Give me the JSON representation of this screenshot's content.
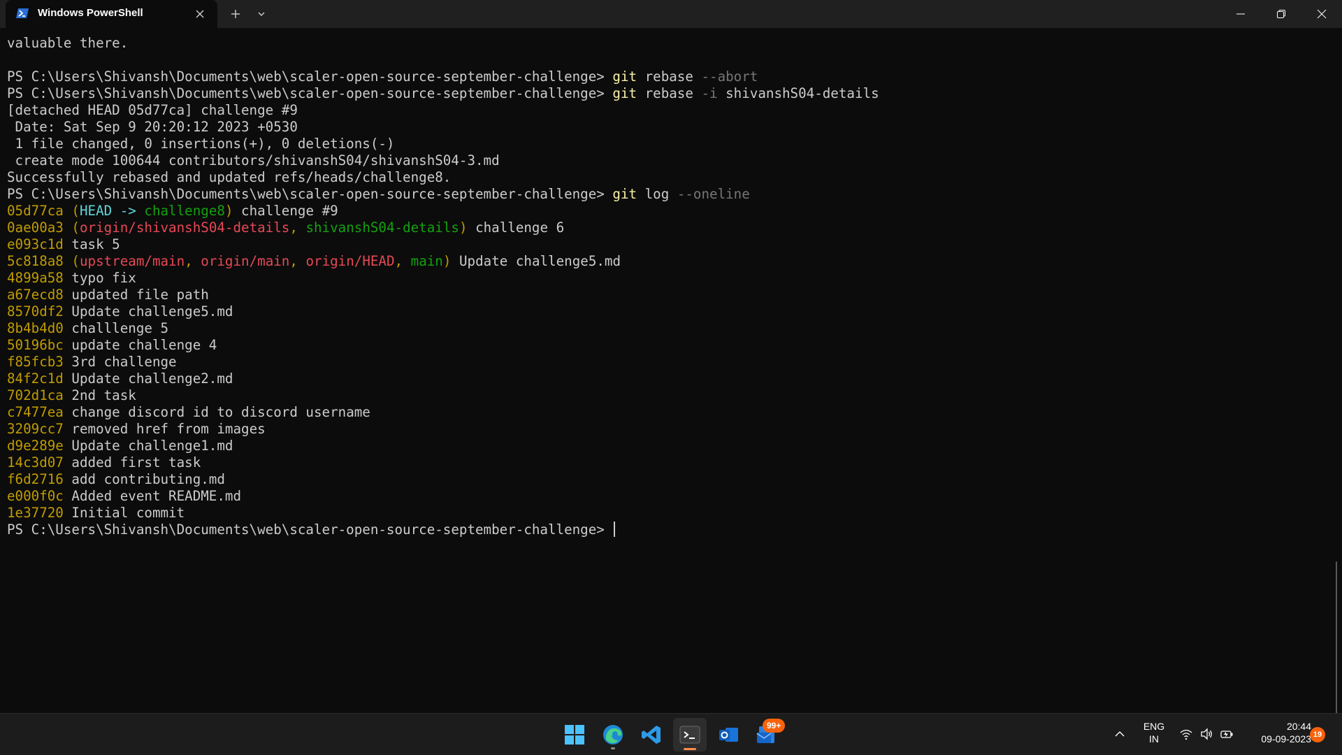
{
  "window": {
    "tab_title": "Windows PowerShell",
    "new_tab_label": "+",
    "icons": [
      "powershell-icon",
      "close-icon",
      "plus-icon",
      "chevron-down-icon",
      "minimize-icon",
      "restore-icon",
      "close-window-icon"
    ]
  },
  "terminal": {
    "lines": [
      [
        [
          "valuable there.",
          "text"
        ]
      ],
      [],
      [
        [
          "PS C:\\Users\\Shivansh\\Documents\\web\\scaler-open-source-september-challenge> ",
          "text"
        ],
        [
          "git",
          "cmd"
        ],
        [
          " rebase ",
          "text"
        ],
        [
          "--abort",
          "flag"
        ]
      ],
      [
        [
          "PS C:\\Users\\Shivansh\\Documents\\web\\scaler-open-source-september-challenge> ",
          "text"
        ],
        [
          "git",
          "cmd"
        ],
        [
          " rebase ",
          "text"
        ],
        [
          "-i",
          "flag"
        ],
        [
          " shivanshS04-details",
          "text"
        ]
      ],
      [
        [
          "[detached HEAD 05d77ca] challenge #9",
          "text"
        ]
      ],
      [
        [
          " Date: Sat Sep 9 20:20:12 2023 +0530",
          "text"
        ]
      ],
      [
        [
          " 1 file changed, 0 insertions(+), 0 deletions(-)",
          "text"
        ]
      ],
      [
        [
          " create mode 100644 contributors/shivanshS04/shivanshS04-3.md",
          "text"
        ]
      ],
      [
        [
          "Successfully rebased and updated refs/heads/challenge8.",
          "text"
        ]
      ],
      [
        [
          "PS C:\\Users\\Shivansh\\Documents\\web\\scaler-open-source-september-challenge> ",
          "text"
        ],
        [
          "git",
          "cmd"
        ],
        [
          " log ",
          "text"
        ],
        [
          "--oneline",
          "flag"
        ]
      ],
      [
        [
          "05d77ca",
          "hash"
        ],
        [
          " (",
          "hash"
        ],
        [
          "HEAD -> ",
          "cyan2"
        ],
        [
          "challenge8",
          "green"
        ],
        [
          ")",
          "hash"
        ],
        [
          " challenge #9",
          "text"
        ]
      ],
      [
        [
          "0ae00a3",
          "hash"
        ],
        [
          " (",
          "hash"
        ],
        [
          "origin/shivanshS04-details",
          "red"
        ],
        [
          ", ",
          "hash"
        ],
        [
          "shivanshS04-details",
          "green"
        ],
        [
          ")",
          "hash"
        ],
        [
          " challenge 6",
          "text"
        ]
      ],
      [
        [
          "e093c1d",
          "hash"
        ],
        [
          " task 5",
          "text"
        ]
      ],
      [
        [
          "5c818a8",
          "hash"
        ],
        [
          " (",
          "hash"
        ],
        [
          "upstream/main",
          "red"
        ],
        [
          ", ",
          "hash"
        ],
        [
          "origin/main",
          "red"
        ],
        [
          ", ",
          "hash"
        ],
        [
          "origin/HEAD",
          "red"
        ],
        [
          ", ",
          "hash"
        ],
        [
          "main",
          "green"
        ],
        [
          ")",
          "hash"
        ],
        [
          " Update challenge5.md",
          "text"
        ]
      ],
      [
        [
          "4899a58",
          "hash"
        ],
        [
          " typo fix",
          "text"
        ]
      ],
      [
        [
          "a67ecd8",
          "hash"
        ],
        [
          " updated file path",
          "text"
        ]
      ],
      [
        [
          "8570df2",
          "hash"
        ],
        [
          " Update challenge5.md",
          "text"
        ]
      ],
      [
        [
          "8b4b4d0",
          "hash"
        ],
        [
          " challlenge 5",
          "text"
        ]
      ],
      [
        [
          "50196bc",
          "hash"
        ],
        [
          " update challenge 4",
          "text"
        ]
      ],
      [
        [
          "f85fcb3",
          "hash"
        ],
        [
          " 3rd challenge",
          "text"
        ]
      ],
      [
        [
          "84f2c1d",
          "hash"
        ],
        [
          " Update challenge2.md",
          "text"
        ]
      ],
      [
        [
          "702d1ca",
          "hash"
        ],
        [
          " 2nd task",
          "text"
        ]
      ],
      [
        [
          "c7477ea",
          "hash"
        ],
        [
          " change discord id to discord username",
          "text"
        ]
      ],
      [
        [
          "3209cc7",
          "hash"
        ],
        [
          " removed href from images",
          "text"
        ]
      ],
      [
        [
          "d9e289e",
          "hash"
        ],
        [
          " Update challenge1.md",
          "text"
        ]
      ],
      [
        [
          "14c3d07",
          "hash"
        ],
        [
          " added first task",
          "text"
        ]
      ],
      [
        [
          "f6d2716",
          "hash"
        ],
        [
          " add contributing.md",
          "text"
        ]
      ],
      [
        [
          "e000f0c",
          "hash"
        ],
        [
          " Added event README.md",
          "text"
        ]
      ],
      [
        [
          "1e37720",
          "hash"
        ],
        [
          " Initial commit",
          "text"
        ]
      ],
      [
        [
          "PS C:\\Users\\Shivansh\\Documents\\web\\scaler-open-source-september-challenge> ",
          "text"
        ]
      ]
    ]
  },
  "taskbar": {
    "apps": [
      "windows-start-icon",
      "edge-icon",
      "vscode-icon",
      "terminal-icon",
      "outlook-icon",
      "mail-icon"
    ],
    "mail_badge": "99+",
    "language_top": "ENG",
    "language_bottom": "IN",
    "time": "20:44",
    "date": "09-09-2023",
    "notifications": "19",
    "tray_icons": [
      "chevron-up-icon",
      "wifi-icon",
      "volume-icon",
      "battery-icon"
    ]
  }
}
